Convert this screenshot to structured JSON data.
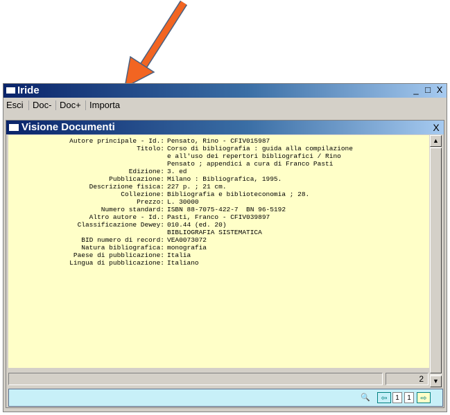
{
  "window": {
    "title": "Iride",
    "buttons": {
      "minimize": "_",
      "maximize": "□",
      "close": "X"
    }
  },
  "menu": [
    "Esci",
    "Doc-",
    "Doc+",
    "Importa"
  ],
  "document_window": {
    "title": "Visione Documenti",
    "close": "X"
  },
  "record": [
    {
      "label": "Autore principale - Id.:",
      "value": "Pensato, Rino - CFIV015987"
    },
    {
      "label": "Titolo:",
      "value": "Corso di bibliografia : guida alla compilazione"
    },
    {
      "label": "",
      "value": "e all'uso dei repertori bibliografici / Rino"
    },
    {
      "label": "",
      "value": "Pensato ; appendici a cura di Franco Pasti"
    },
    {
      "label": "Edizione:",
      "value": "3. ed"
    },
    {
      "label": "Pubblicazione:",
      "value": "Milano : Bibliografica, 1995."
    },
    {
      "label": "Descrizione fisica:",
      "value": "227 p. ; 21 cm."
    },
    {
      "label": "Collezione:",
      "value": "Bibliografia e biblioteconomia ; 28."
    },
    {
      "label": "Prezzo:",
      "value": "L. 30000"
    },
    {
      "label": "Numero standard:",
      "value": "ISBN 88-7075-422-7  BN 96-5192"
    },
    {
      "label": "Altro autore - Id.:",
      "value": "Pasti, Franco - CFIV039897"
    },
    {
      "label": "Classificazione Dewey:",
      "value": "010.44 (ed. 20)"
    },
    {
      "label": "",
      "value": "BIBLIOGRAFIA SISTEMATICA"
    },
    {
      "label": "BID numero di record:",
      "value": "VEA0073072"
    },
    {
      "label": "Natura bibliografica:",
      "value": "monografia"
    },
    {
      "label": "Paese di pubblicazione:",
      "value": "Italia"
    },
    {
      "label": "Lingua di pubblicazione:",
      "value": "Italiano"
    }
  ],
  "status": {
    "left": "",
    "record_number": "2"
  },
  "toolbar": {
    "binoculars": "🔍",
    "prev": "⇦",
    "page_a": "1",
    "page_b": "1",
    "next": "⇨"
  },
  "colors": {
    "content_bg": "#ffffc8",
    "toolbar_bg": "#c8f0f8",
    "arrow": "#f26522"
  }
}
